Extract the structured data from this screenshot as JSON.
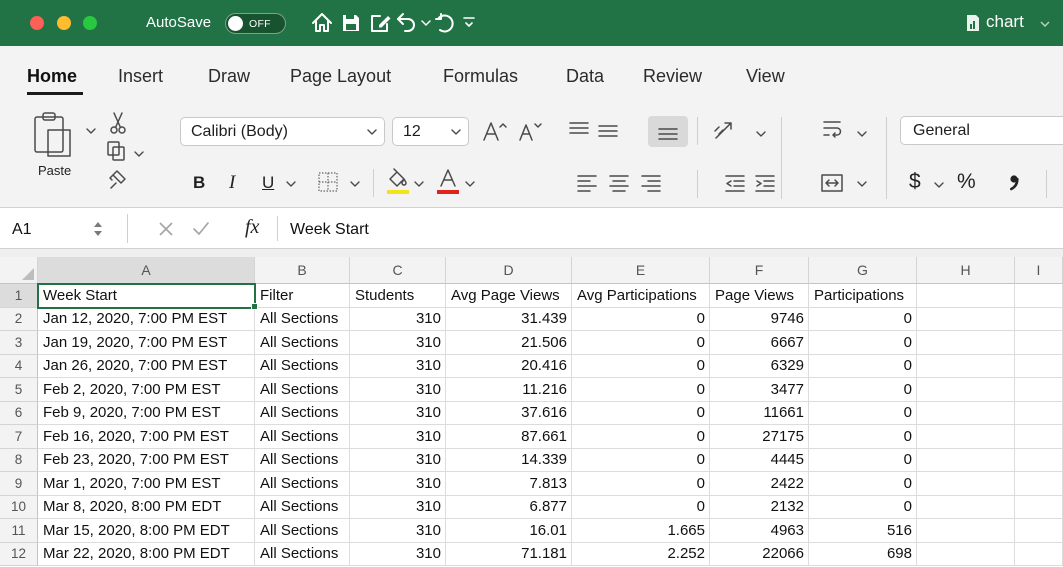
{
  "window": {
    "autosave_label": "AutoSave",
    "autosave_state": "OFF",
    "document_title": "chart"
  },
  "colors": {
    "title_bar": "#217346",
    "selection_border": "#217346",
    "fill_color_swatch": "#f5e31a",
    "font_color_swatch": "#e0241b",
    "close_light": "#fe5f57",
    "minimize_light": "#febc2e",
    "zoom_light": "#28c840"
  },
  "quick_access_icons": [
    "home-icon",
    "save-icon",
    "edit-icon",
    "undo-icon",
    "redo-icon",
    "customize-icon"
  ],
  "ribbon": {
    "tabs": [
      {
        "label": "Home",
        "active": true
      },
      {
        "label": "Insert"
      },
      {
        "label": "Draw"
      },
      {
        "label": "Page Layout"
      },
      {
        "label": "Formulas"
      },
      {
        "label": "Data"
      },
      {
        "label": "Review"
      },
      {
        "label": "View"
      }
    ],
    "clipboard": {
      "paste_label": "Paste"
    },
    "font": {
      "name": "Calibri (Body)",
      "size": "12",
      "bold_label": "B",
      "italic_label": "I",
      "underline_label": "U"
    },
    "alignment": {
      "bottom_align_active": true
    },
    "number": {
      "format": "General",
      "currency_label": "$",
      "percent_label": "%"
    }
  },
  "formula_bar": {
    "name_box": "A1",
    "fx_label": "fx",
    "content": "Week Start"
  },
  "sheet": {
    "columns": [
      "A",
      "B",
      "C",
      "D",
      "E",
      "F",
      "G",
      "H",
      "I"
    ],
    "rows": [
      {
        "number": "1",
        "cells": [
          "Week Start",
          "Filter",
          "Students",
          "Avg Page Views",
          "Avg Participations",
          "Page Views",
          "Participations"
        ]
      },
      {
        "number": "2",
        "cells": [
          "Jan 12, 2020, 7:00 PM EST",
          "All Sections",
          "310",
          "31.439",
          "0",
          "9746",
          "0"
        ]
      },
      {
        "number": "3",
        "cells": [
          "Jan 19, 2020, 7:00 PM EST",
          "All Sections",
          "310",
          "21.506",
          "0",
          "6667",
          "0"
        ]
      },
      {
        "number": "4",
        "cells": [
          "Jan 26, 2020, 7:00 PM EST",
          "All Sections",
          "310",
          "20.416",
          "0",
          "6329",
          "0"
        ]
      },
      {
        "number": "5",
        "cells": [
          "Feb 2, 2020, 7:00 PM EST",
          "All Sections",
          "310",
          "11.216",
          "0",
          "3477",
          "0"
        ]
      },
      {
        "number": "6",
        "cells": [
          "Feb 9, 2020, 7:00 PM EST",
          "All Sections",
          "310",
          "37.616",
          "0",
          "11661",
          "0"
        ]
      },
      {
        "number": "7",
        "cells": [
          "Feb 16, 2020, 7:00 PM EST",
          "All Sections",
          "310",
          "87.661",
          "0",
          "27175",
          "0"
        ]
      },
      {
        "number": "8",
        "cells": [
          "Feb 23, 2020, 7:00 PM EST",
          "All Sections",
          "310",
          "14.339",
          "0",
          "4445",
          "0"
        ]
      },
      {
        "number": "9",
        "cells": [
          "Mar 1, 2020, 7:00 PM EST",
          "All Sections",
          "310",
          "7.813",
          "0",
          "2422",
          "0"
        ]
      },
      {
        "number": "10",
        "cells": [
          "Mar 8, 2020, 8:00 PM EDT",
          "All Sections",
          "310",
          "6.877",
          "0",
          "2132",
          "0"
        ]
      },
      {
        "number": "11",
        "cells": [
          "Mar 15, 2020, 8:00 PM EDT",
          "All Sections",
          "310",
          "16.01",
          "1.665",
          "4963",
          "516"
        ]
      },
      {
        "number": "12",
        "cells": [
          "Mar 22, 2020, 8:00 PM EDT",
          "All Sections",
          "310",
          "71.181",
          "2.252",
          "22066",
          "698"
        ]
      }
    ]
  }
}
